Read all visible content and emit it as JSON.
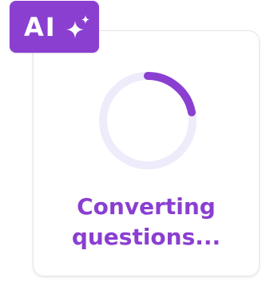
{
  "badge": {
    "label": "AI",
    "icon": "sparkle-icon"
  },
  "loader": {
    "icon": "progress-ring",
    "progress_fraction": 0.22
  },
  "status": {
    "line1": "Converting",
    "line2": "questions..."
  },
  "colors": {
    "accent": "#8a3fd1",
    "ring_track": "#eeebfb",
    "card_border": "#e6e6ea"
  }
}
